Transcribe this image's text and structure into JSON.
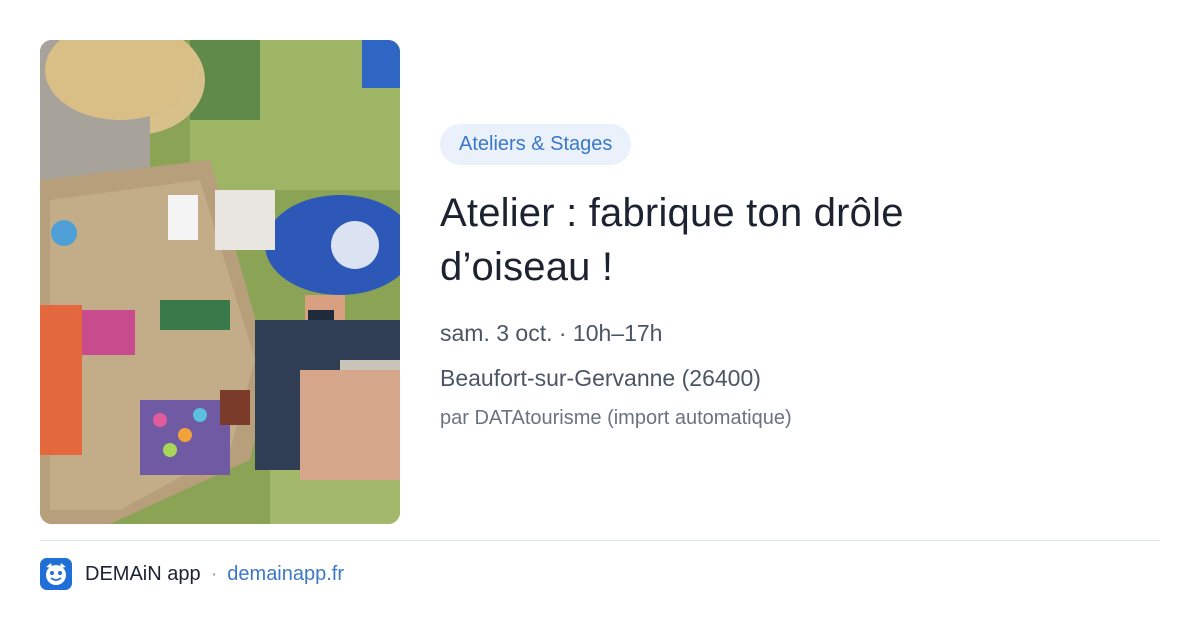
{
  "event": {
    "category": "Ateliers & Stages",
    "title": "Atelier : fabrique ton drôle d’oiseau !",
    "date": "sam. 3 oct. · 10h–17h",
    "location": "Beaufort-sur-Gervanne (26400)",
    "source": "par DATAtourisme (import automatique)"
  },
  "footer": {
    "app_name": "DEMAiN app",
    "separator": "·",
    "url": "demainapp.fr"
  },
  "colors": {
    "accent": "#3b78c9",
    "category_bg": "#eaf1fb",
    "title": "#1c2230",
    "meta": "#4b5563",
    "divider": "#d9e1ea",
    "logo_bg": "#1f6fd6"
  },
  "icons": {
    "app_logo": "demain-app-logo-icon"
  }
}
